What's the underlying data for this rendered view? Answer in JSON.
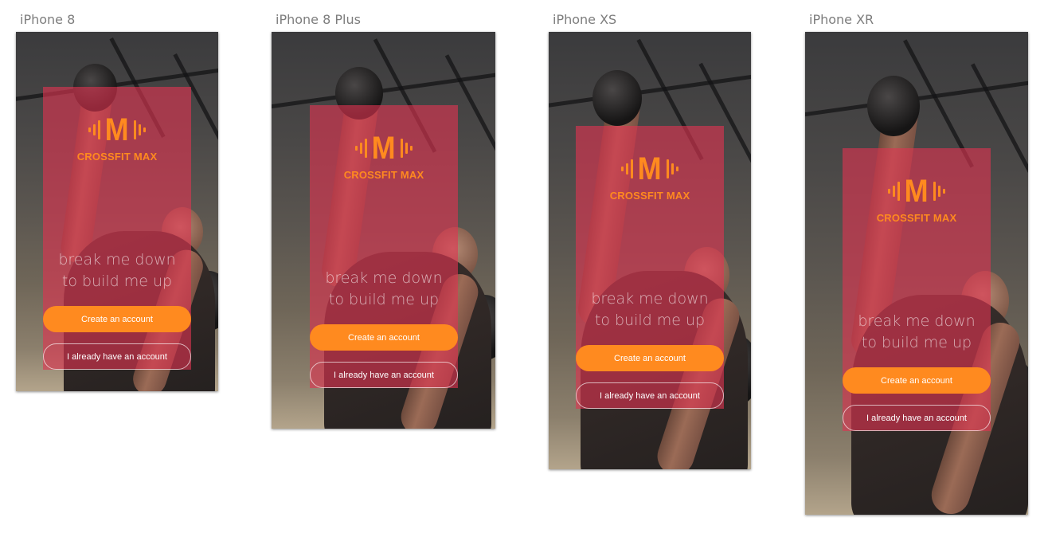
{
  "devices": [
    {
      "label": "iPhone 8",
      "brand": "CROSSFIT MAX",
      "tagline_line1": "break me down",
      "tagline_line2": "to build me up",
      "create_account_label": "Create an account",
      "login_label": "I already have an account"
    },
    {
      "label": "iPhone 8 Plus",
      "brand": "CROSSFIT MAX",
      "tagline_line1": "break me down",
      "tagline_line2": "to build me up",
      "create_account_label": "Create an account",
      "login_label": "I already have an account"
    },
    {
      "label": "iPhone XS",
      "brand": "CROSSFIT MAX",
      "tagline_line1": "break me down",
      "tagline_line2": "to build me up",
      "create_account_label": "Create an account",
      "login_label": "I already have an account"
    },
    {
      "label": "iPhone XR",
      "brand": "CROSSFIT MAX",
      "tagline_line1": "break me down",
      "tagline_line2": "to build me up",
      "create_account_label": "Create an account",
      "login_label": "I already have an account"
    }
  ],
  "colors": {
    "accent": "#ff8a1f",
    "overlay": "#de3450",
    "label": "#7d7d7d"
  },
  "icons": {
    "logo": "dumbbell-m-logo-icon"
  }
}
